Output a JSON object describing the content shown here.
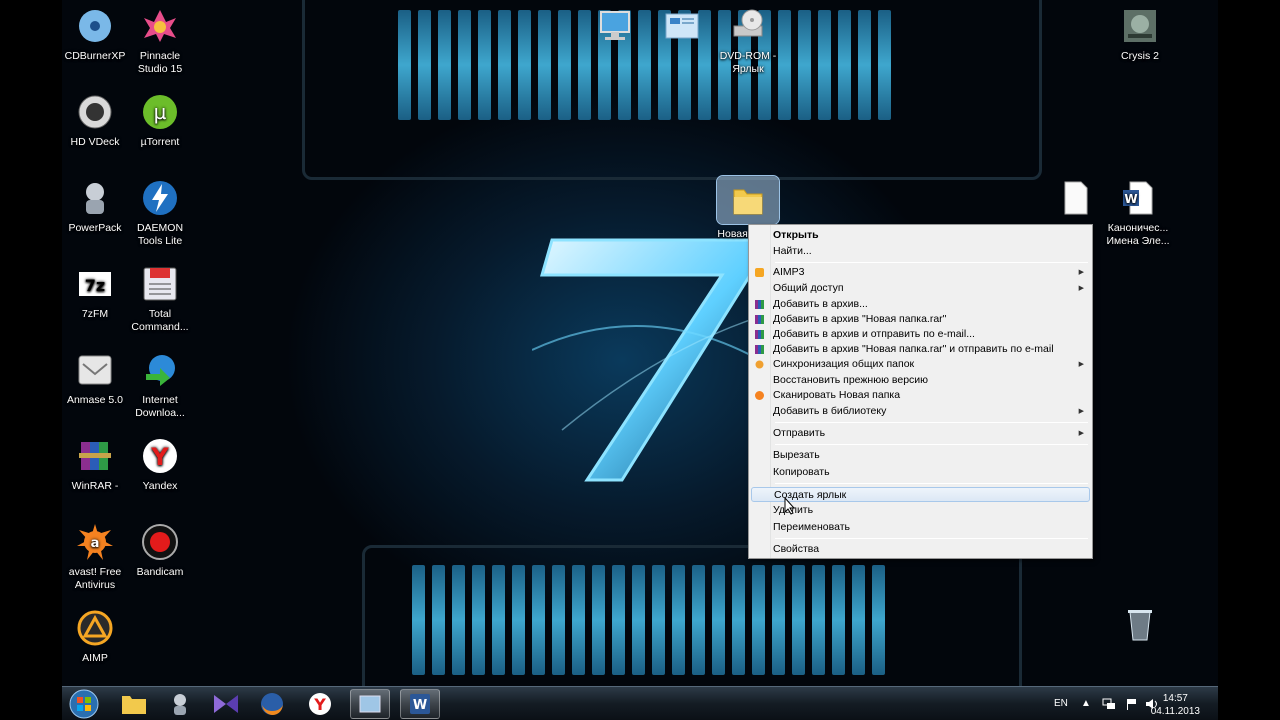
{
  "desktop": {
    "icons": [
      {
        "label": "CDBurnerXP"
      },
      {
        "label": "Pinnacle Studio 15"
      },
      {
        "label": "HD VDeck"
      },
      {
        "label": "µTorrent"
      },
      {
        "label": "PowerPack"
      },
      {
        "label": "DAEMON Tools Lite"
      },
      {
        "label": "7zFM"
      },
      {
        "label": "Total Command..."
      },
      {
        "label": "Anmase 5.0"
      },
      {
        "label": "Internet Downloa..."
      },
      {
        "label": "WinRAR -"
      },
      {
        "label": "Yandex"
      },
      {
        "label": "avast! Free Antivirus"
      },
      {
        "label": "Bandicam"
      },
      {
        "label": "AIMP"
      },
      {
        "label": "DVD-ROM - Ярлык"
      },
      {
        "label": "Crysis 2"
      },
      {
        "label": "Новая папка"
      },
      {
        "label": "Каноничес... Имена Эле..."
      }
    ]
  },
  "context_menu": {
    "items": [
      {
        "label": "Открыть"
      },
      {
        "label": "Найти..."
      },
      {
        "label": "AIMP3"
      },
      {
        "label": "Общий доступ"
      },
      {
        "label": "Добавить в архив..."
      },
      {
        "label": "Добавить в архив \"Новая папка.rar\""
      },
      {
        "label": "Добавить в архив и отправить по e-mail..."
      },
      {
        "label": "Добавить в архив \"Новая папка.rar\" и отправить по e-mail"
      },
      {
        "label": "Синхронизация общих папок"
      },
      {
        "label": "Восстановить прежнюю версию"
      },
      {
        "label": "Сканировать Новая папка"
      },
      {
        "label": "Добавить в библиотеку"
      },
      {
        "label": "Отправить"
      },
      {
        "label": "Вырезать"
      },
      {
        "label": "Копировать"
      },
      {
        "label": "Создать ярлык"
      },
      {
        "label": "Удалить"
      },
      {
        "label": "Переименовать"
      },
      {
        "label": "Свойства"
      }
    ]
  },
  "taskbar": {
    "language": "EN",
    "time": "14:57",
    "date": "04.11.2013"
  },
  "colors": {
    "menu_bg": "#f0f0f0",
    "menu_highlight": "#dce8f5",
    "wallpaper_glow": "#49c3f0"
  }
}
